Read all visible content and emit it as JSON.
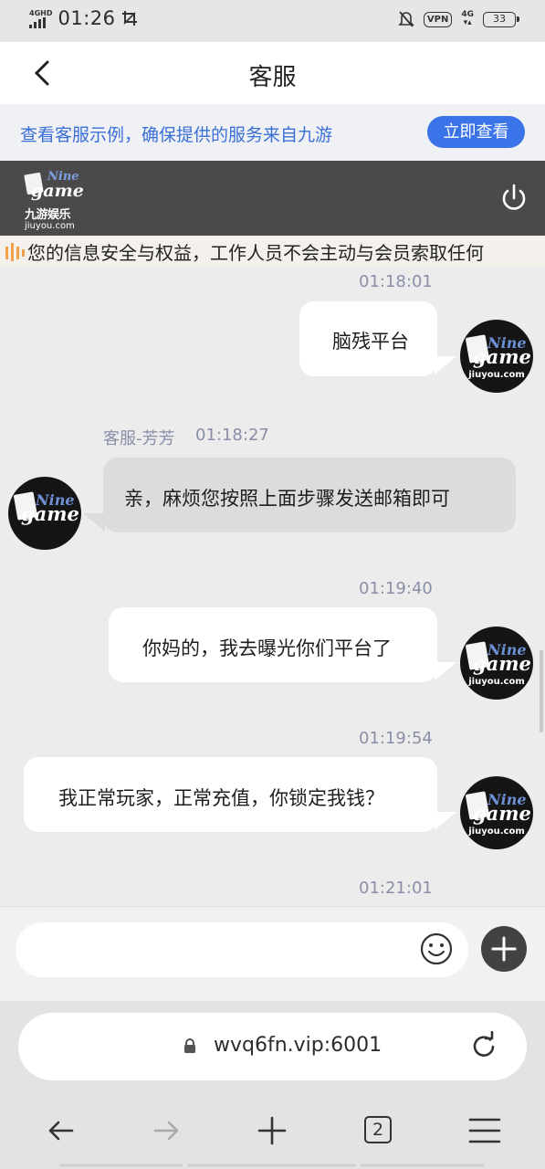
{
  "status_bar": {
    "network_label": "4GHD",
    "time": "01:26",
    "vpn_label": "VPN",
    "net_type": "4G",
    "battery": "33"
  },
  "header": {
    "title": "客服"
  },
  "notice": {
    "text": "查看客服示例，确保提供的服务来自九游",
    "button_label": "立即查看"
  },
  "brand": {
    "logo_top": "Nine",
    "logo_main": "game",
    "logo_cn": "九游娱乐",
    "logo_url": "jiuyou.com"
  },
  "marquee": {
    "text": "您的信息安全与权益，工作人员不会主动与会员索取任何"
  },
  "messages": [
    {
      "time": "01:18:01",
      "side": "right",
      "text": "脑残平台"
    },
    {
      "sender": "客服-芳芳",
      "time": "01:18:27",
      "side": "left",
      "text": "亲，麻烦您按照上面步骤发送邮箱即可"
    },
    {
      "time": "01:19:40",
      "side": "right",
      "text": "你妈的，我去曝光你们平台了"
    },
    {
      "time": "01:19:54",
      "side": "right",
      "text": "我正常玩家，正常充值，你锁定我钱？"
    },
    {
      "time": "01:21:01"
    }
  ],
  "avatar": {
    "nine": "Nine",
    "game": "game",
    "url": "jiuyou.com"
  },
  "composer": {
    "placeholder": ""
  },
  "browser": {
    "url": "wvq6fn.vip:6001",
    "tab_count": "2"
  },
  "colors": {
    "accent": "#3a74e8",
    "notice_text": "#3a6fd6",
    "brand_bar": "#4a4a4a",
    "timestamp": "#8a8fa8"
  }
}
